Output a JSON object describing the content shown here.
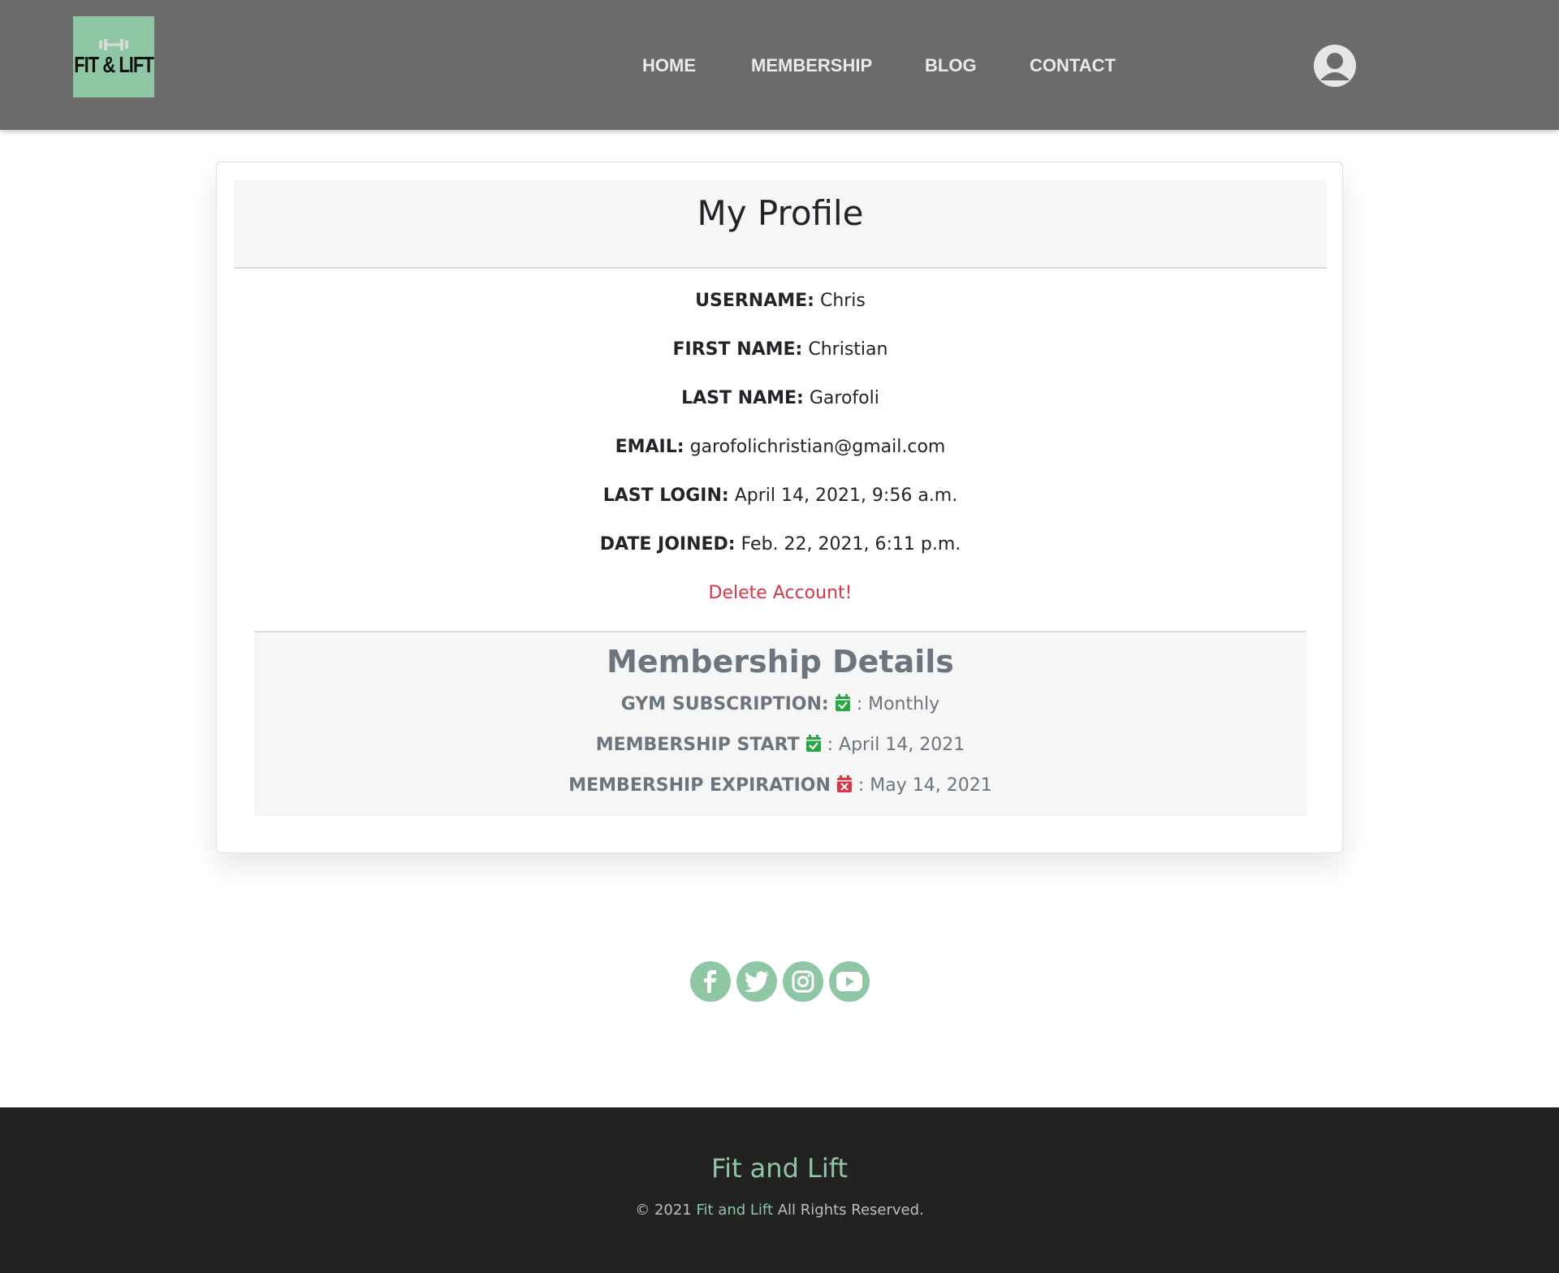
{
  "nav": {
    "logo_text": "FIT & LIFT",
    "links": [
      "HOME",
      "MEMBERSHIP",
      "BLOG",
      "CONTACT"
    ]
  },
  "profile": {
    "title": "My Profile",
    "fields": [
      {
        "label": "USERNAME:",
        "value": "Chris"
      },
      {
        "label": "FIRST NAME:",
        "value": "Christian"
      },
      {
        "label": "LAST NAME:",
        "value": "Garofoli"
      },
      {
        "label": "EMAIL:",
        "value": "garofolichristian@gmail.com"
      },
      {
        "label": "LAST LOGIN:",
        "value": "April 14, 2021, 9:56 a.m."
      },
      {
        "label": "DATE JOINED:",
        "value": "Feb. 22, 2021, 6:11 p.m."
      }
    ],
    "delete_label": "Delete Account!"
  },
  "membership": {
    "title": "Membership Details",
    "rows": [
      {
        "label": "GYM SUBSCRIPTION:",
        "sep": ": ",
        "value": "Monthly",
        "icon": "calendar-check-icon"
      },
      {
        "label": "MEMBERSHIP START",
        "sep": ": ",
        "value": "April 14, 2021",
        "icon": "calendar-check-icon"
      },
      {
        "label": "MEMBERSHIP EXPIRATION",
        "sep": ": ",
        "value": "May 14, 2021",
        "icon": "calendar-x-icon"
      }
    ]
  },
  "social": [
    "facebook-icon",
    "twitter-icon",
    "instagram-icon",
    "youtube-icon"
  ],
  "footer": {
    "title": "Fit and Lift",
    "copy_prefix": "© 2021 ",
    "copy_brand": "Fit and Lift",
    "copy_suffix": " All Rights Reserved."
  },
  "colors": {
    "navbar": "#6b6b6b",
    "brand_green": "#8fc7a4",
    "danger": "#dc3545",
    "success": "#28a745",
    "footer": "#222222"
  }
}
